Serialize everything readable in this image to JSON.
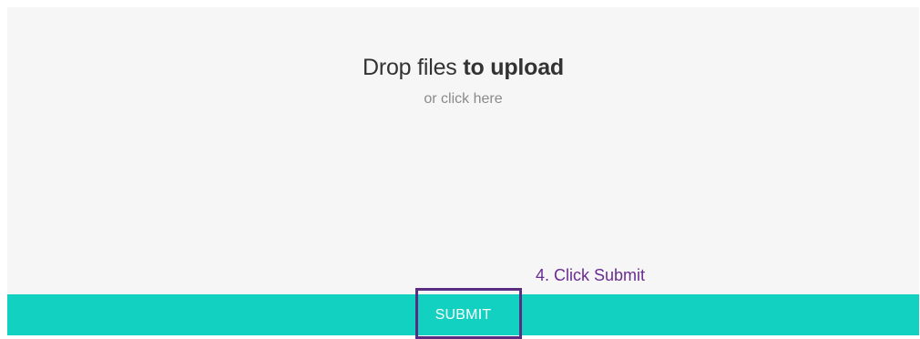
{
  "dropzone": {
    "title_plain": "Drop files ",
    "title_strong": "to upload",
    "subtitle": "or click here"
  },
  "annotation": {
    "text": "4. Click Submit",
    "color": "#6a2c91"
  },
  "submit": {
    "label": "SUBMIT",
    "color": "#13d1c1"
  },
  "highlight": {
    "color": "#5b2d82"
  }
}
